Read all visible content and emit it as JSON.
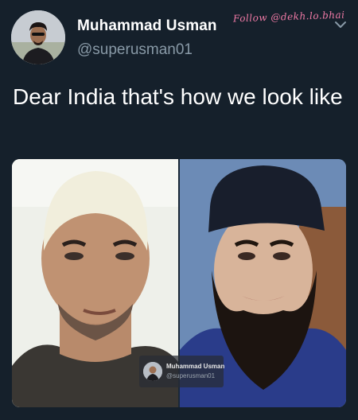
{
  "tweet": {
    "author_name": "Muhammad Usman",
    "author_handle": "@superusman01",
    "text": "Dear India that's how we look like"
  },
  "watermark": "Follow @dekh.lo.bhai",
  "media_badge": {
    "name": "Muhammad Usman",
    "handle": "@superusman01"
  },
  "icons": [
    "avatar",
    "chevron-down-icon"
  ],
  "colors": {
    "background": "#15202b",
    "text": "#ffffff",
    "muted": "#8899a6",
    "watermark": "#f07aa6"
  }
}
